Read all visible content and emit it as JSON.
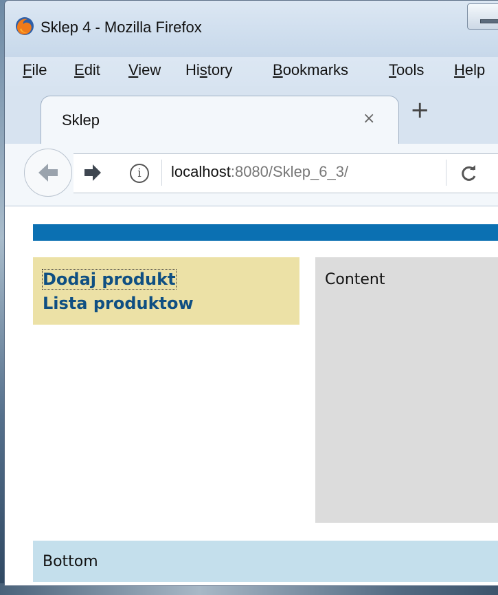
{
  "window": {
    "title": "Sklep 4 - Mozilla Firefox"
  },
  "menu": {
    "items": [
      {
        "accel": "F",
        "rest": "ile"
      },
      {
        "accel": "E",
        "rest": "dit"
      },
      {
        "accel": "V",
        "rest": "iew"
      },
      {
        "pre": "Hi",
        "accel": "s",
        "rest": "tory"
      },
      {
        "accel": "B",
        "rest": "ookmarks"
      },
      {
        "accel": "T",
        "rest": "ools"
      },
      {
        "accel": "H",
        "rest": "elp"
      }
    ]
  },
  "tab": {
    "label": "Sklep",
    "close_glyph": "×",
    "new_tab_glyph": "+"
  },
  "urlbar": {
    "host": "localhost",
    "rest": ":8080/Sklep_6_3/"
  },
  "page": {
    "menu_links": [
      "Dodaj produkt",
      "Lista produktow"
    ],
    "content_text": "Content",
    "bottom_text": "Bottom"
  },
  "colors": {
    "top_bar": "#0b70b2",
    "side_menu": "#ece1a6",
    "content": "#dcdcdc",
    "bottom": "#c4dfec",
    "link": "#0f4f82"
  },
  "icons": {
    "browser_logo": "firefox-logo-icon",
    "back": "back-arrow-icon",
    "forward": "forward-arrow-icon",
    "info": "info-icon",
    "reload": "reload-icon"
  }
}
